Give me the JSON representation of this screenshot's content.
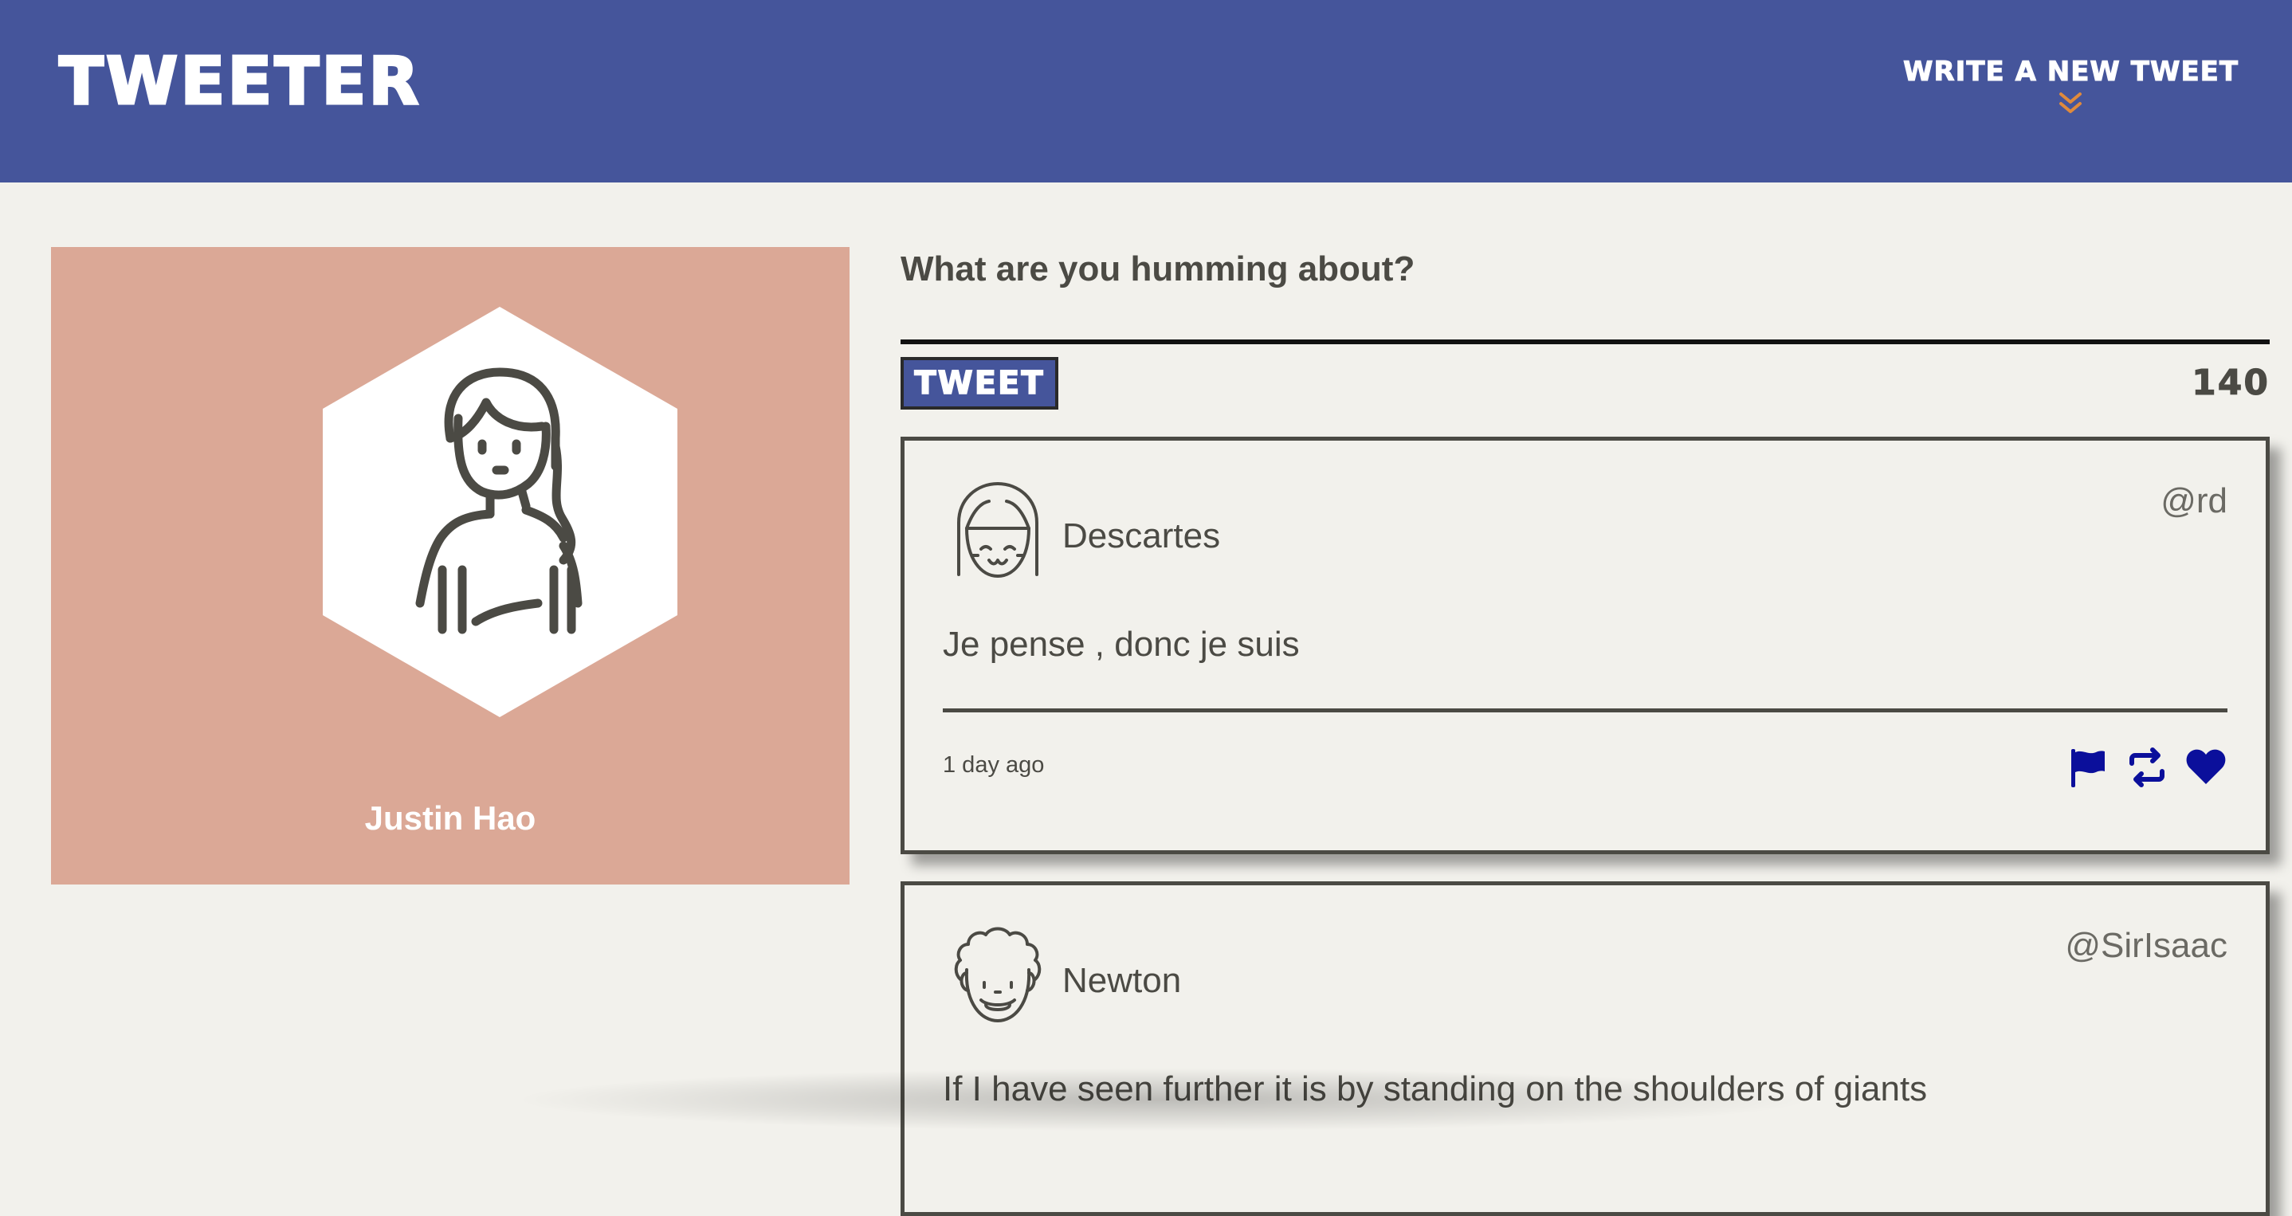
{
  "nav": {
    "brand": "TWEETER",
    "compose_label": "WRITE A NEW TWEET",
    "compose_icon": "double-chevron-down-icon",
    "compose_icon_color": "#e08a3c"
  },
  "colors": {
    "nav_bg": "#45559b",
    "page_bg": "#f2f1ec",
    "profile_bg": "#dba896",
    "text": "#4b4a44",
    "action_icons": "#0b0f9b"
  },
  "profile": {
    "name": "Justin Hao",
    "avatar_icon": "woman-avatar-icon"
  },
  "composer": {
    "prompt": "What are you humming about?",
    "textarea_value": "",
    "button_label": "TWEET",
    "counter": "140"
  },
  "tweets": [
    {
      "name": "Descartes",
      "handle": "@rd",
      "avatar_icon": "girl-bangs-avatar-icon",
      "content": "Je pense , donc je suis",
      "time": "1 day ago",
      "actions": [
        "flag-icon",
        "retweet-icon",
        "heart-icon"
      ]
    },
    {
      "name": "Newton",
      "handle": "@SirIsaac",
      "avatar_icon": "curly-hair-avatar-icon",
      "content": "If I have seen further it is by standing on the shoulders of giants"
    }
  ]
}
